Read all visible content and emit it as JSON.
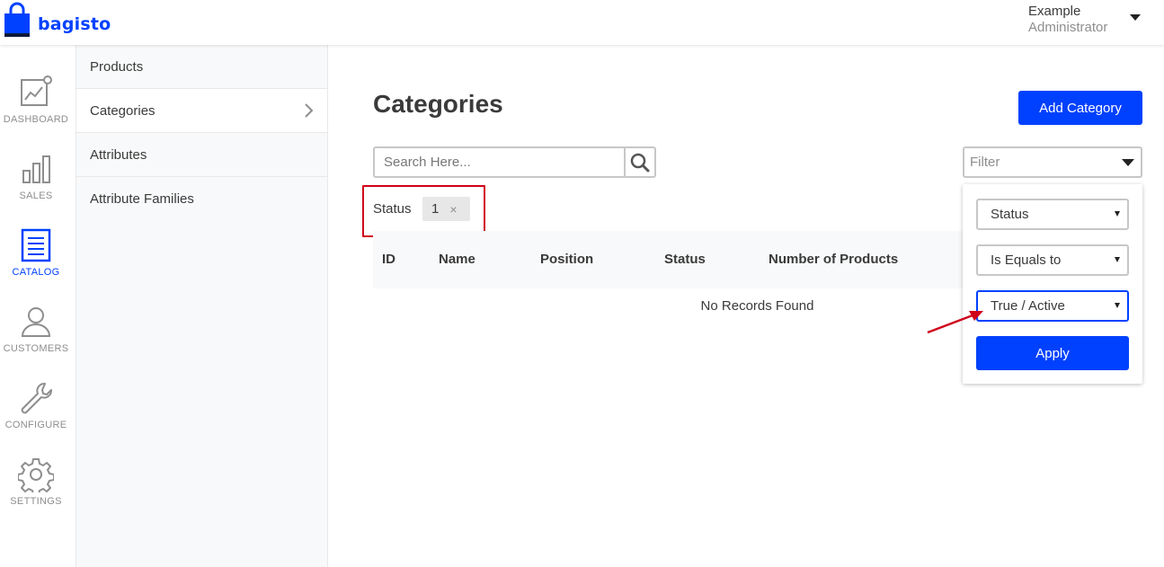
{
  "brand": {
    "name": "bagisto",
    "color": "#0041ff"
  },
  "user": {
    "name": "Example",
    "role": "Administrator"
  },
  "nav": {
    "items": [
      {
        "label": "DASHBOARD",
        "icon": "dashboard-icon"
      },
      {
        "label": "SALES",
        "icon": "bar-chart-icon"
      },
      {
        "label": "CATALOG",
        "icon": "catalog-list-icon",
        "active": true
      },
      {
        "label": "CUSTOMERS",
        "icon": "user-icon"
      },
      {
        "label": "CONFIGURE",
        "icon": "wrench-icon"
      },
      {
        "label": "SETTINGS",
        "icon": "gear-icon"
      }
    ]
  },
  "subnav": {
    "items": [
      {
        "label": "Products"
      },
      {
        "label": "Categories",
        "active": true
      },
      {
        "label": "Attributes"
      },
      {
        "label": "Attribute Families"
      }
    ]
  },
  "main": {
    "title": "Categories",
    "add_button": "Add Category",
    "search": {
      "placeholder": "Search Here..."
    },
    "filter": {
      "placeholder": "Filter"
    },
    "active_filter": {
      "label": "Status",
      "value": "1",
      "remove": "×"
    },
    "table": {
      "columns": [
        "ID",
        "Name",
        "Position",
        "Status",
        "Number of Products"
      ],
      "empty_message": "No Records Found"
    }
  },
  "filter_panel": {
    "column": "Status",
    "condition": "Is Equals to",
    "value": "True / Active",
    "apply": "Apply"
  },
  "colors": {
    "accent": "#0041ff",
    "highlight": "#d0021b"
  }
}
